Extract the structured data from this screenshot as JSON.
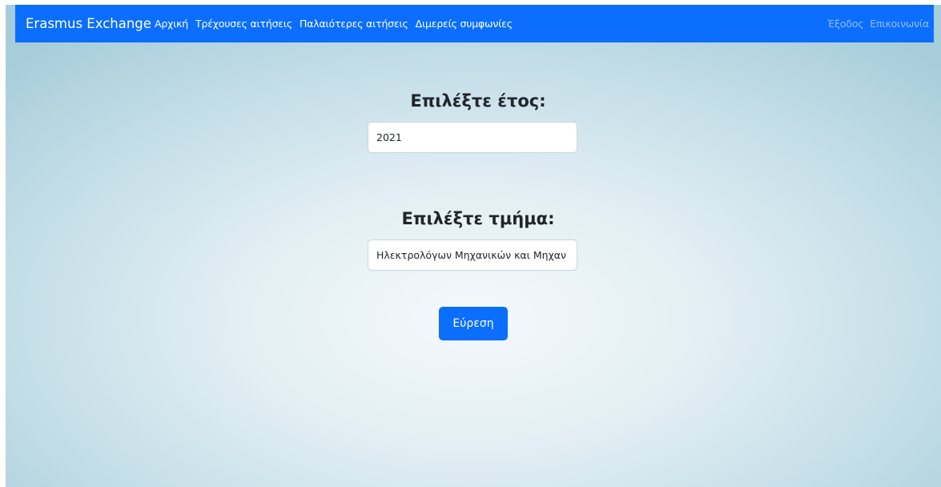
{
  "navbar": {
    "brand": "Erasmus Exchange",
    "links": [
      "Αρχική",
      "Τρέχουσες αιτήσεις",
      "Παλαιότερες αιτήσεις",
      "Διμερείς συμφωνίες"
    ],
    "right_links": [
      "Έξοδος",
      "Επικοινωνία"
    ],
    "color": "#0b6efd"
  },
  "year_section": {
    "heading": "Επιλέξτε έτος:",
    "value": "2021"
  },
  "department_section": {
    "heading": "Επιλέξτε τμήμα:",
    "value": "Ηλεκτρολόγων Μηχανικών και Μηχαν"
  },
  "search_button": {
    "label": "Εύρεση"
  }
}
